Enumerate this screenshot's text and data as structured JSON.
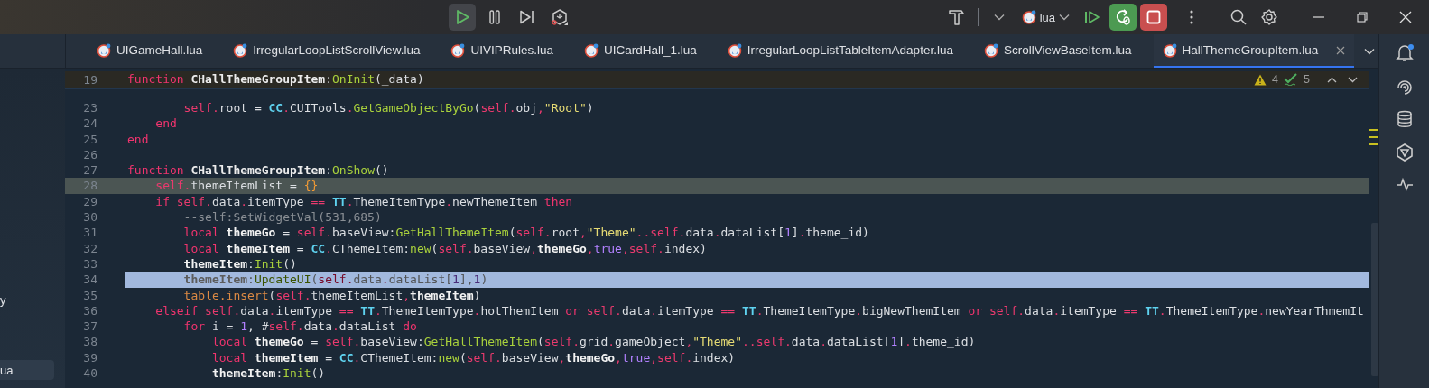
{
  "toolbar": {
    "run_config": {
      "label": "lua"
    }
  },
  "tabs": [
    {
      "label": "UIGameHall.lua",
      "selected": false
    },
    {
      "label": "IrregularLoopListScrollView.lua",
      "selected": false
    },
    {
      "label": "UIVIPRules.lua",
      "selected": false
    },
    {
      "label": "UICardHall_1.lua",
      "selected": false
    },
    {
      "label": "IrregularLoopListTableItemAdapter.lua",
      "selected": false
    },
    {
      "label": "ScrollViewBaseItem.lua",
      "selected": false
    },
    {
      "label": "HallThemeGroupItem.lua",
      "selected": true
    }
  ],
  "sidebar": {
    "items": [
      {
        "label": "y",
        "selected": false
      },
      {
        "label": "ua",
        "selected": true
      }
    ]
  },
  "problems": {
    "warnings": "4",
    "checks": "5"
  },
  "editor": {
    "sticky_line": {
      "number": "19",
      "tokens": [
        {
          "text": "function ",
          "kind": "kw"
        },
        {
          "text": "CHallThemeGroupItem",
          "kind": "cls"
        },
        {
          "text": ":",
          "kind": "plain"
        },
        {
          "text": "OnInit",
          "kind": "fn"
        },
        {
          "text": "(_data)",
          "kind": "plain"
        }
      ]
    },
    "lines": [
      {
        "number": "23",
        "current": false,
        "selected": false,
        "tokens": [
          {
            "text": "        self.",
            "kind": "self"
          },
          {
            "text": "root = ",
            "kind": "plain"
          },
          {
            "text": "CC",
            "kind": "cc"
          },
          {
            "text": ".",
            "kind": "op"
          },
          {
            "text": "CUITools",
            "kind": "plain"
          },
          {
            "text": ".",
            "kind": "op"
          },
          {
            "text": "GetGameObjectByGo",
            "kind": "fn"
          },
          {
            "text": "(",
            "kind": "plain"
          },
          {
            "text": "self.",
            "kind": "self"
          },
          {
            "text": "obj",
            "kind": "plain"
          },
          {
            "text": ",",
            "kind": "op"
          },
          {
            "text": "\"Root\"",
            "kind": "str"
          },
          {
            "text": ")",
            "kind": "plain"
          }
        ]
      },
      {
        "number": "24",
        "current": false,
        "selected": false,
        "tokens": [
          {
            "text": "    end",
            "kind": "kw"
          }
        ]
      },
      {
        "number": "25",
        "current": false,
        "selected": false,
        "tokens": [
          {
            "text": "end",
            "kind": "kw"
          }
        ]
      },
      {
        "number": "26",
        "current": false,
        "selected": false
      },
      {
        "number": "27",
        "current": false,
        "selected": false,
        "tokens": [
          {
            "text": "function ",
            "kind": "kw"
          },
          {
            "text": "CHallThemeGroupItem",
            "kind": "cls"
          },
          {
            "text": ":",
            "kind": "plain"
          },
          {
            "text": "OnShow",
            "kind": "fn"
          },
          {
            "text": "()",
            "kind": "plain"
          }
        ]
      },
      {
        "number": "28",
        "current": true,
        "selected": false,
        "tokens": [
          {
            "text": "    self.",
            "kind": "self"
          },
          {
            "text": "themeItemList = ",
            "kind": "plain"
          },
          {
            "text": "{}",
            "kind": "lit"
          }
        ]
      },
      {
        "number": "29",
        "current": false,
        "selected": false,
        "tokens": [
          {
            "text": "    if ",
            "kind": "kw"
          },
          {
            "text": "self.",
            "kind": "self"
          },
          {
            "text": "data",
            "kind": "plain"
          },
          {
            "text": ".",
            "kind": "op"
          },
          {
            "text": "itemType ",
            "kind": "plain"
          },
          {
            "text": "== ",
            "kind": "op"
          },
          {
            "text": "TT",
            "kind": "cc"
          },
          {
            "text": ".",
            "kind": "op"
          },
          {
            "text": "ThemeItemType",
            "kind": "plain"
          },
          {
            "text": ".",
            "kind": "op"
          },
          {
            "text": "newThemeItem ",
            "kind": "plain"
          },
          {
            "text": "then",
            "kind": "kw"
          }
        ]
      },
      {
        "number": "30",
        "current": false,
        "selected": false,
        "tokens": [
          {
            "text": "        --self:SetWidgetVal(531,685)",
            "kind": "cm"
          }
        ]
      },
      {
        "number": "31",
        "current": false,
        "selected": false,
        "tokens": [
          {
            "text": "        local ",
            "kind": "kw"
          },
          {
            "text": "themeGo",
            "kind": "local"
          },
          {
            "text": " = ",
            "kind": "plain"
          },
          {
            "text": "self.",
            "kind": "self"
          },
          {
            "text": "baseView:",
            "kind": "plain"
          },
          {
            "text": "GetHallThemeItem",
            "kind": "fn"
          },
          {
            "text": "(",
            "kind": "plain"
          },
          {
            "text": "self.",
            "kind": "self"
          },
          {
            "text": "root",
            "kind": "plain"
          },
          {
            "text": ",",
            "kind": "op"
          },
          {
            "text": "\"Theme\"",
            "kind": "str"
          },
          {
            "text": "..",
            "kind": "op"
          },
          {
            "text": "self.",
            "kind": "self"
          },
          {
            "text": "data",
            "kind": "plain"
          },
          {
            "text": ".",
            "kind": "op"
          },
          {
            "text": "dataList[",
            "kind": "plain"
          },
          {
            "text": "1",
            "kind": "num"
          },
          {
            "text": "]",
            "kind": "plain"
          },
          {
            "text": ".",
            "kind": "op"
          },
          {
            "text": "theme_id)",
            "kind": "plain"
          }
        ]
      },
      {
        "number": "32",
        "current": false,
        "selected": false,
        "tokens": [
          {
            "text": "        local ",
            "kind": "kw"
          },
          {
            "text": "themeItem",
            "kind": "local"
          },
          {
            "text": " = ",
            "kind": "plain"
          },
          {
            "text": "CC",
            "kind": "cc"
          },
          {
            "text": ".",
            "kind": "op"
          },
          {
            "text": "CThemeItem:",
            "kind": "plain"
          },
          {
            "text": "new",
            "kind": "fn"
          },
          {
            "text": "(",
            "kind": "plain"
          },
          {
            "text": "self.",
            "kind": "self"
          },
          {
            "text": "baseView",
            "kind": "plain"
          },
          {
            "text": ",",
            "kind": "op"
          },
          {
            "text": "themeGo",
            "kind": "local"
          },
          {
            "text": ",",
            "kind": "op"
          },
          {
            "text": "true",
            "kind": "num"
          },
          {
            "text": ",",
            "kind": "op"
          },
          {
            "text": "self.",
            "kind": "self"
          },
          {
            "text": "index)",
            "kind": "plain"
          }
        ]
      },
      {
        "number": "33",
        "current": false,
        "selected": false,
        "tokens": [
          {
            "text": "        themeItem",
            "kind": "local"
          },
          {
            "text": ":",
            "kind": "plain"
          },
          {
            "text": "Init",
            "kind": "fn"
          },
          {
            "text": "()",
            "kind": "plain"
          }
        ]
      },
      {
        "number": "34",
        "current": false,
        "selected": true,
        "tokens": [
          {
            "text": "        themeItem",
            "kind": "local"
          },
          {
            "text": ":",
            "kind": "plain"
          },
          {
            "text": "UpdateUI",
            "kind": "fn"
          },
          {
            "text": "(",
            "kind": "plain"
          },
          {
            "text": "self.",
            "kind": "self"
          },
          {
            "text": "data",
            "kind": "plain"
          },
          {
            "text": ".",
            "kind": "op"
          },
          {
            "text": "dataList[",
            "kind": "plain"
          },
          {
            "text": "1",
            "kind": "num"
          },
          {
            "text": "],",
            "kind": "plain"
          },
          {
            "text": "1",
            "kind": "num"
          },
          {
            "text": ")",
            "kind": "plain"
          }
        ]
      },
      {
        "number": "35",
        "current": false,
        "selected": false,
        "tokens": [
          {
            "text": "        table.insert",
            "kind": "lib"
          },
          {
            "text": "(",
            "kind": "plain"
          },
          {
            "text": "self.",
            "kind": "self"
          },
          {
            "text": "themeItemList",
            "kind": "plain"
          },
          {
            "text": ",",
            "kind": "op"
          },
          {
            "text": "themeItem",
            "kind": "local"
          },
          {
            "text": ")",
            "kind": "plain"
          }
        ]
      },
      {
        "number": "36",
        "current": false,
        "selected": false,
        "tokens": [
          {
            "text": "    elseif ",
            "kind": "kw"
          },
          {
            "text": "self.",
            "kind": "self"
          },
          {
            "text": "data",
            "kind": "plain"
          },
          {
            "text": ".",
            "kind": "op"
          },
          {
            "text": "itemType ",
            "kind": "plain"
          },
          {
            "text": "== ",
            "kind": "op"
          },
          {
            "text": "TT",
            "kind": "cc"
          },
          {
            "text": ".",
            "kind": "op"
          },
          {
            "text": "ThemeItemType",
            "kind": "plain"
          },
          {
            "text": ".",
            "kind": "op"
          },
          {
            "text": "hotThemItem ",
            "kind": "plain"
          },
          {
            "text": "or ",
            "kind": "kw"
          },
          {
            "text": "self.",
            "kind": "self"
          },
          {
            "text": "data",
            "kind": "plain"
          },
          {
            "text": ".",
            "kind": "op"
          },
          {
            "text": "itemType ",
            "kind": "plain"
          },
          {
            "text": "== ",
            "kind": "op"
          },
          {
            "text": "TT",
            "kind": "cc"
          },
          {
            "text": ".",
            "kind": "op"
          },
          {
            "text": "ThemeItemType",
            "kind": "plain"
          },
          {
            "text": ".",
            "kind": "op"
          },
          {
            "text": "bigNewThemItem ",
            "kind": "plain"
          },
          {
            "text": "or ",
            "kind": "kw"
          },
          {
            "text": "self.",
            "kind": "self"
          },
          {
            "text": "data",
            "kind": "plain"
          },
          {
            "text": ".",
            "kind": "op"
          },
          {
            "text": "itemType ",
            "kind": "plain"
          },
          {
            "text": "== ",
            "kind": "op"
          },
          {
            "text": "TT",
            "kind": "cc"
          },
          {
            "text": ".",
            "kind": "op"
          },
          {
            "text": "ThemeItemType",
            "kind": "plain"
          },
          {
            "text": ".",
            "kind": "op"
          },
          {
            "text": "newYearThmemIt",
            "kind": "plain"
          }
        ]
      },
      {
        "number": "37",
        "current": false,
        "selected": false,
        "tokens": [
          {
            "text": "        for ",
            "kind": "kw"
          },
          {
            "text": "i = ",
            "kind": "plain"
          },
          {
            "text": "1",
            "kind": "num"
          },
          {
            "text": ", #",
            "kind": "plain"
          },
          {
            "text": "self.",
            "kind": "self"
          },
          {
            "text": "data",
            "kind": "plain"
          },
          {
            "text": ".",
            "kind": "op"
          },
          {
            "text": "dataList ",
            "kind": "plain"
          },
          {
            "text": "do",
            "kind": "kw"
          }
        ]
      },
      {
        "number": "38",
        "current": false,
        "selected": false,
        "tokens": [
          {
            "text": "            local ",
            "kind": "kw"
          },
          {
            "text": "themeGo",
            "kind": "local"
          },
          {
            "text": " = ",
            "kind": "plain"
          },
          {
            "text": "self.",
            "kind": "self"
          },
          {
            "text": "baseView:",
            "kind": "plain"
          },
          {
            "text": "GetHallThemeItem",
            "kind": "fn"
          },
          {
            "text": "(",
            "kind": "plain"
          },
          {
            "text": "self.",
            "kind": "self"
          },
          {
            "text": "grid",
            "kind": "plain"
          },
          {
            "text": ".",
            "kind": "op"
          },
          {
            "text": "gameObject",
            "kind": "plain"
          },
          {
            "text": ",",
            "kind": "op"
          },
          {
            "text": "\"Theme\"",
            "kind": "str"
          },
          {
            "text": "..",
            "kind": "op"
          },
          {
            "text": "self.",
            "kind": "self"
          },
          {
            "text": "data",
            "kind": "plain"
          },
          {
            "text": ".",
            "kind": "op"
          },
          {
            "text": "dataList[",
            "kind": "plain"
          },
          {
            "text": "1",
            "kind": "num"
          },
          {
            "text": "]",
            "kind": "plain"
          },
          {
            "text": ".",
            "kind": "op"
          },
          {
            "text": "theme_id)",
            "kind": "plain"
          }
        ]
      },
      {
        "number": "39",
        "current": false,
        "selected": false,
        "tokens": [
          {
            "text": "            local ",
            "kind": "kw"
          },
          {
            "text": "themeItem",
            "kind": "local"
          },
          {
            "text": " = ",
            "kind": "plain"
          },
          {
            "text": "CC",
            "kind": "cc"
          },
          {
            "text": ".",
            "kind": "op"
          },
          {
            "text": "CThemeItem:",
            "kind": "plain"
          },
          {
            "text": "new",
            "kind": "fn"
          },
          {
            "text": "(",
            "kind": "plain"
          },
          {
            "text": "self.",
            "kind": "self"
          },
          {
            "text": "baseView",
            "kind": "plain"
          },
          {
            "text": ",",
            "kind": "op"
          },
          {
            "text": "themeGo",
            "kind": "local"
          },
          {
            "text": ",",
            "kind": "op"
          },
          {
            "text": "true",
            "kind": "num"
          },
          {
            "text": ",",
            "kind": "op"
          },
          {
            "text": "self.",
            "kind": "self"
          },
          {
            "text": "index)",
            "kind": "plain"
          }
        ]
      },
      {
        "number": "40",
        "current": false,
        "selected": false,
        "tokens": [
          {
            "text": "            themeItem",
            "kind": "local"
          },
          {
            "text": ":",
            "kind": "plain"
          },
          {
            "text": "Init",
            "kind": "fn"
          },
          {
            "text": "()",
            "kind": "plain"
          }
        ]
      }
    ]
  }
}
